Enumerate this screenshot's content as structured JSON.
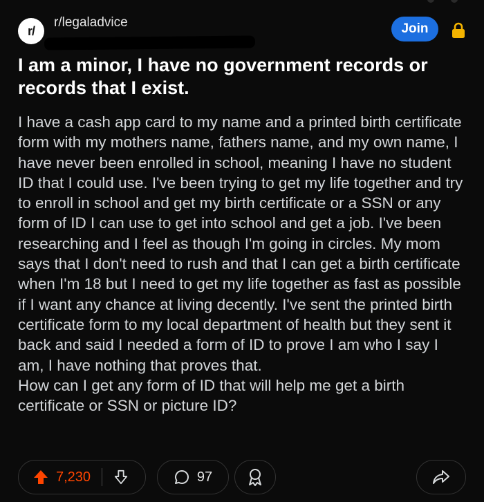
{
  "header": {
    "avatar_text": "r/",
    "subreddit": "r/legaladvice",
    "join_label": "Join"
  },
  "post": {
    "title": "I am a minor, I have no government records or records that I exist.",
    "body": "I have a cash app card to my name and a printed birth certificate form with my mothers name, fathers name, and my own name, I have never been enrolled in school, meaning I have no student ID that I could use. I've been trying to get my life together and try to enroll in school and get my birth certificate or a SSN or any form of ID I can use to get into school and get a job. I've been researching and I feel as though I'm going in circles. My mom says that I don't need to rush and that I can get a birth certificate when I'm 18 but I need to get my life together as fast as possible if I want any chance at living decently. I've sent the printed birth certificate form to my local department of health but they sent it back and said I needed a form of ID to prove I am who I say I am, I have nothing that proves that.\nHow can I get any form of ID that will help me get a birth certificate or SSN or picture ID?"
  },
  "actions": {
    "vote_count": "7,230",
    "comment_count": "97"
  },
  "colors": {
    "background": "#0b0b0b",
    "join_button": "#1c6fe0",
    "upvote_active": "#ff4500",
    "lock": "#f5b400"
  },
  "icons": [
    "lock-icon",
    "upvote-icon",
    "downvote-icon",
    "comment-icon",
    "award-icon",
    "share-icon"
  ]
}
